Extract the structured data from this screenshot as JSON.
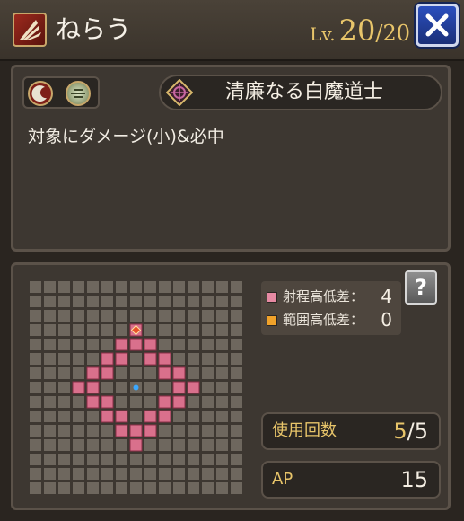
{
  "header": {
    "title": "ねらう",
    "level_label": "Lv.",
    "level_current": "20",
    "level_separator": "/",
    "level_max": "20",
    "close_icon": "close-x-icon"
  },
  "ability": {
    "weapon_icons": [
      "sickle-icon",
      "orb-icon"
    ],
    "job_emblem_icon": "white-mage-emblem-icon",
    "job_name": "清廉なる白魔道士",
    "description": "対象にダメージ(小)&必中"
  },
  "range_map": {
    "grid_cols": 15,
    "grid_rows": 15,
    "center": [
      7,
      7
    ],
    "hit_cells": [
      [
        7,
        3
      ],
      [
        6,
        4
      ],
      [
        7,
        4
      ],
      [
        8,
        4
      ],
      [
        5,
        5
      ],
      [
        6,
        5
      ],
      [
        8,
        5
      ],
      [
        9,
        5
      ],
      [
        4,
        6
      ],
      [
        5,
        6
      ],
      [
        9,
        6
      ],
      [
        10,
        6
      ],
      [
        3,
        7
      ],
      [
        4,
        7
      ],
      [
        10,
        7
      ],
      [
        11,
        7
      ],
      [
        4,
        8
      ],
      [
        5,
        8
      ],
      [
        9,
        8
      ],
      [
        10,
        8
      ],
      [
        5,
        9
      ],
      [
        6,
        9
      ],
      [
        8,
        9
      ],
      [
        9,
        9
      ],
      [
        6,
        10
      ],
      [
        7,
        10
      ],
      [
        8,
        10
      ],
      [
        7,
        11
      ]
    ],
    "marker_cell": [
      7,
      3
    ],
    "colors": {
      "hit": "#d9708c",
      "cell": "#6e675e",
      "marker": "#e8512a",
      "center": "#3aa8ff"
    }
  },
  "legend": {
    "range_height_label": "射程高低差：",
    "range_height_value": "4",
    "range_height_color": "#e78aa3",
    "area_height_label": "範囲高低差：",
    "area_height_value": "0",
    "area_height_color": "#f0a22a"
  },
  "help": {
    "label": "?"
  },
  "stats": {
    "uses_label": "使用回数",
    "uses_current": "5",
    "uses_separator": "/",
    "uses_max": "5",
    "ap_label": "AP",
    "ap_value": "15"
  }
}
